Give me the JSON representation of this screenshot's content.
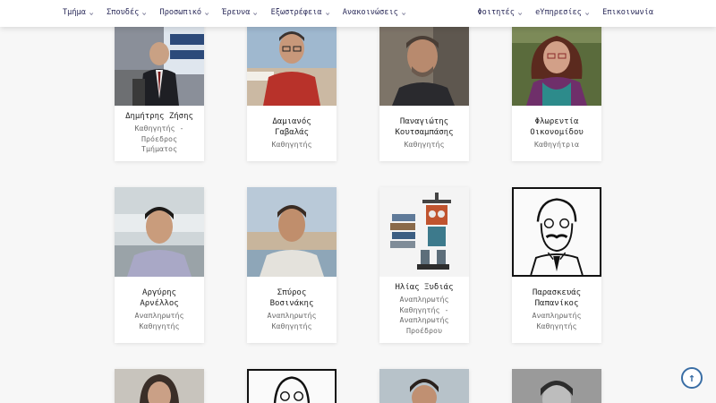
{
  "nav": {
    "left": [
      {
        "label": "Τμήμα",
        "icon": "chevron-down-icon"
      },
      {
        "label": "Σπουδές",
        "icon": "chevron-down-icon"
      },
      {
        "label": "Προσωπικό",
        "icon": "chevron-down-icon"
      },
      {
        "label": "Έρευνα",
        "icon": "chevron-down-icon"
      },
      {
        "label": "Εξωστρέφεια",
        "icon": "chevron-down-icon"
      },
      {
        "label": "Ανακοινώσεις",
        "icon": "chevron-down-icon"
      }
    ],
    "right": [
      {
        "label": "Φοιτητές",
        "icon": "chevron-down-icon"
      },
      {
        "label": "eΥπηρεσίες",
        "icon": "chevron-down-icon"
      },
      {
        "label": "Επικοινωνία"
      }
    ]
  },
  "staff": [
    {
      "name1": "Δημήτρης Ζήσης",
      "name2": "",
      "roles": [
        "Καθηγητής -",
        "Πρόεδρος",
        "Τμήματος"
      ]
    },
    {
      "name1": "Δαμιανός",
      "name2": "Γαβαλάς",
      "roles": [
        "Καθηγητής"
      ]
    },
    {
      "name1": "Παναγιώτης",
      "name2": "Κουτσαμπάσης",
      "roles": [
        "Καθηγητής"
      ]
    },
    {
      "name1": "Φλωρεντία",
      "name2": "Οικονομίδου",
      "roles": [
        "Καθηγήτρια"
      ]
    },
    {
      "name1": "Αργύρης",
      "name2": "Αρνέλλος",
      "roles": [
        "Αναπληρωτής",
        "Καθηγητής"
      ]
    },
    {
      "name1": "Σπύρος",
      "name2": "Βοσινάκης",
      "roles": [
        "Αναπληρωτής",
        "Καθηγητής"
      ]
    },
    {
      "name1": "Ηλίας Ξυδιάς",
      "name2": "",
      "roles": [
        "Αναπληρωτής",
        "Καθηγητής -",
        "Αναπληρωτής",
        "Προέδρου"
      ]
    },
    {
      "name1": "Παρασκευάς",
      "name2": "Παπανίκος",
      "roles": [
        "Αναπληρωτής",
        "Καθηγητής"
      ]
    }
  ],
  "colors": {
    "nav_text": "#2b2b5a",
    "accent": "#3a6ea5"
  },
  "scroll_top_icon": "arrow-up-icon"
}
